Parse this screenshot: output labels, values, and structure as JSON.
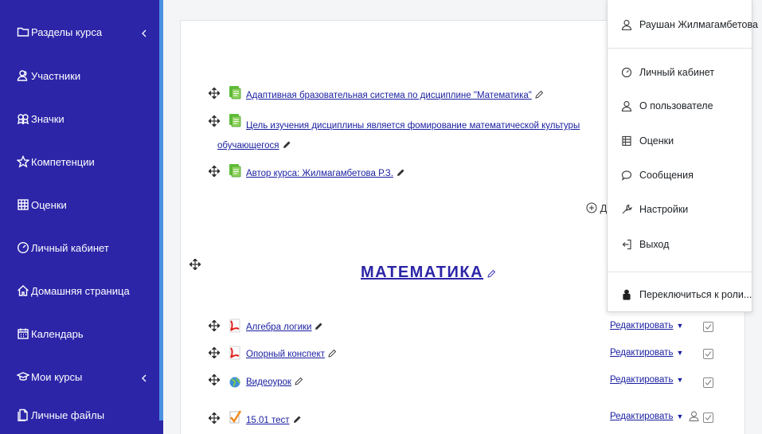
{
  "sidebar": {
    "items": [
      {
        "label": "Разделы курса",
        "icon": "folder-icon"
      },
      {
        "label": "Участники",
        "icon": "users-icon"
      },
      {
        "label": "Значки",
        "icon": "badges-icon"
      },
      {
        "label": "Компетенции",
        "icon": "star-icon"
      },
      {
        "label": "Оценки",
        "icon": "table-icon"
      },
      {
        "label": "Личный кабинет",
        "icon": "dashboard-icon"
      },
      {
        "label": "Домашняя страница",
        "icon": "home-icon"
      },
      {
        "label": "Календарь",
        "icon": "calendar-icon"
      },
      {
        "label": "Мои курсы",
        "icon": "courses-icon"
      },
      {
        "label": "Личные файлы",
        "icon": "files-icon"
      }
    ]
  },
  "top_activities": [
    {
      "label": "Адаптивная бразовательная система по дисциплине \"Математика\""
    },
    {
      "label_line1": "Цель изучения дисциплины является фомирование математической культуры",
      "label_line2": "обучающегося"
    },
    {
      "label": "Автор курса: Жилмагамбетова Р.З."
    }
  ],
  "add_hint": "Д",
  "section": {
    "title": "МАТЕМАТИКА"
  },
  "section_activities": [
    {
      "label": "Алгебра логики",
      "edit": "Редактировать"
    },
    {
      "label": "Опорный конспект",
      "edit": "Редактировать"
    },
    {
      "label": "Видеоурок",
      "edit": "Редактировать"
    },
    {
      "label": "15.01 тест",
      "edit": "Редактировать"
    }
  ],
  "user_menu": {
    "user_name": "Раушан Жилмагамбетова",
    "items": [
      {
        "label": "Личный кабинет",
        "icon": "dashboard-icon"
      },
      {
        "label": "О пользователе",
        "icon": "user-icon"
      },
      {
        "label": "Оценки",
        "icon": "grades-icon"
      },
      {
        "label": "Сообщения",
        "icon": "message-icon"
      },
      {
        "label": "Настройки",
        "icon": "wrench-icon"
      },
      {
        "label": "Выход",
        "icon": "logout-icon"
      }
    ],
    "switch_role": "Переключиться к роли..."
  },
  "colors": {
    "sidebar": "#2c25a8",
    "link": "#1a1fa0",
    "accent_bar": "#4a90e2"
  }
}
